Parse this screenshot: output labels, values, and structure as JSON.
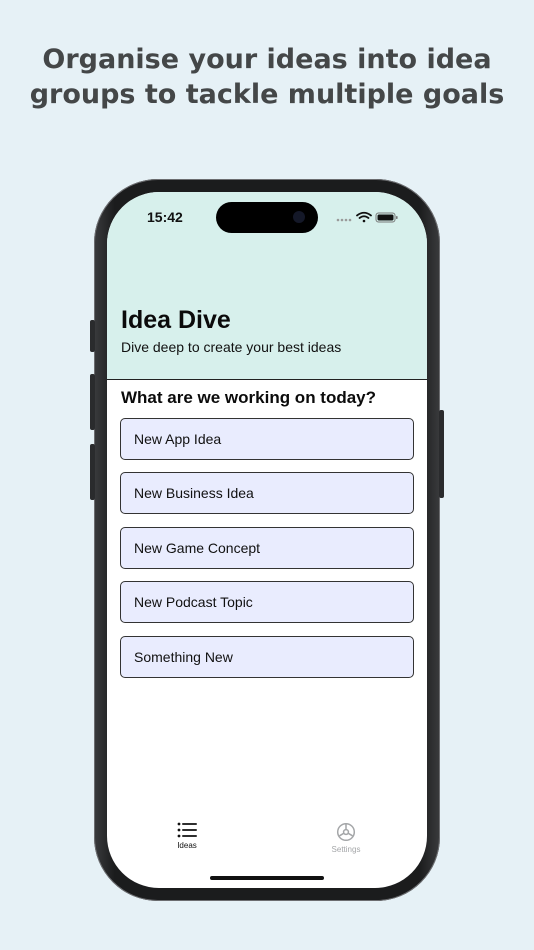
{
  "headline": {
    "line1": "Organise your ideas into idea",
    "line2": "groups to tackle multiple goals"
  },
  "status_bar": {
    "time": "15:42"
  },
  "header": {
    "title": "Idea Dive",
    "subtitle": "Dive deep to create your best ideas"
  },
  "main": {
    "question": "What are we working on today?",
    "ideas": [
      {
        "label": "New App Idea"
      },
      {
        "label": "New Business Idea"
      },
      {
        "label": "New Game Concept"
      },
      {
        "label": "New Podcast Topic"
      },
      {
        "label": "Something New"
      }
    ]
  },
  "tab_bar": {
    "tabs": [
      {
        "label": "Ideas",
        "icon": "list-icon",
        "active": true
      },
      {
        "label": "Settings",
        "icon": "gear-icon",
        "active": false
      }
    ]
  },
  "colors": {
    "background": "#e6f1f6",
    "header_bg": "#d7f0ec",
    "button_bg": "#e9ecfe",
    "headline_text": "#444748",
    "inactive_tab": "#a4a6a8"
  }
}
